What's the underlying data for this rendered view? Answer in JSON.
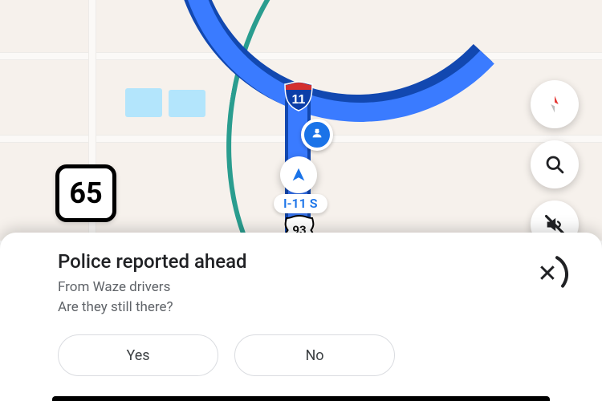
{
  "map": {
    "route_label": "I-11 S",
    "interstate_number": "11",
    "us_highway_number": "93",
    "speed_limit": "65"
  },
  "controls": {
    "compass_name": "compass",
    "search_name": "search",
    "mute_name": "mute"
  },
  "alert": {
    "title": "Police reported ahead",
    "source_line": "From Waze drivers",
    "question": "Are they still there?",
    "yes_label": "Yes",
    "no_label": "No",
    "close_label": "✕"
  },
  "icons": {
    "report": "police-report-icon",
    "current_location": "navigation-arrow-icon",
    "interstate": "interstate-shield-icon",
    "us_shield": "us-highway-shield-icon",
    "compass": "compass-icon",
    "search": "search-icon",
    "mute": "volume-off-icon",
    "close": "close-icon"
  }
}
